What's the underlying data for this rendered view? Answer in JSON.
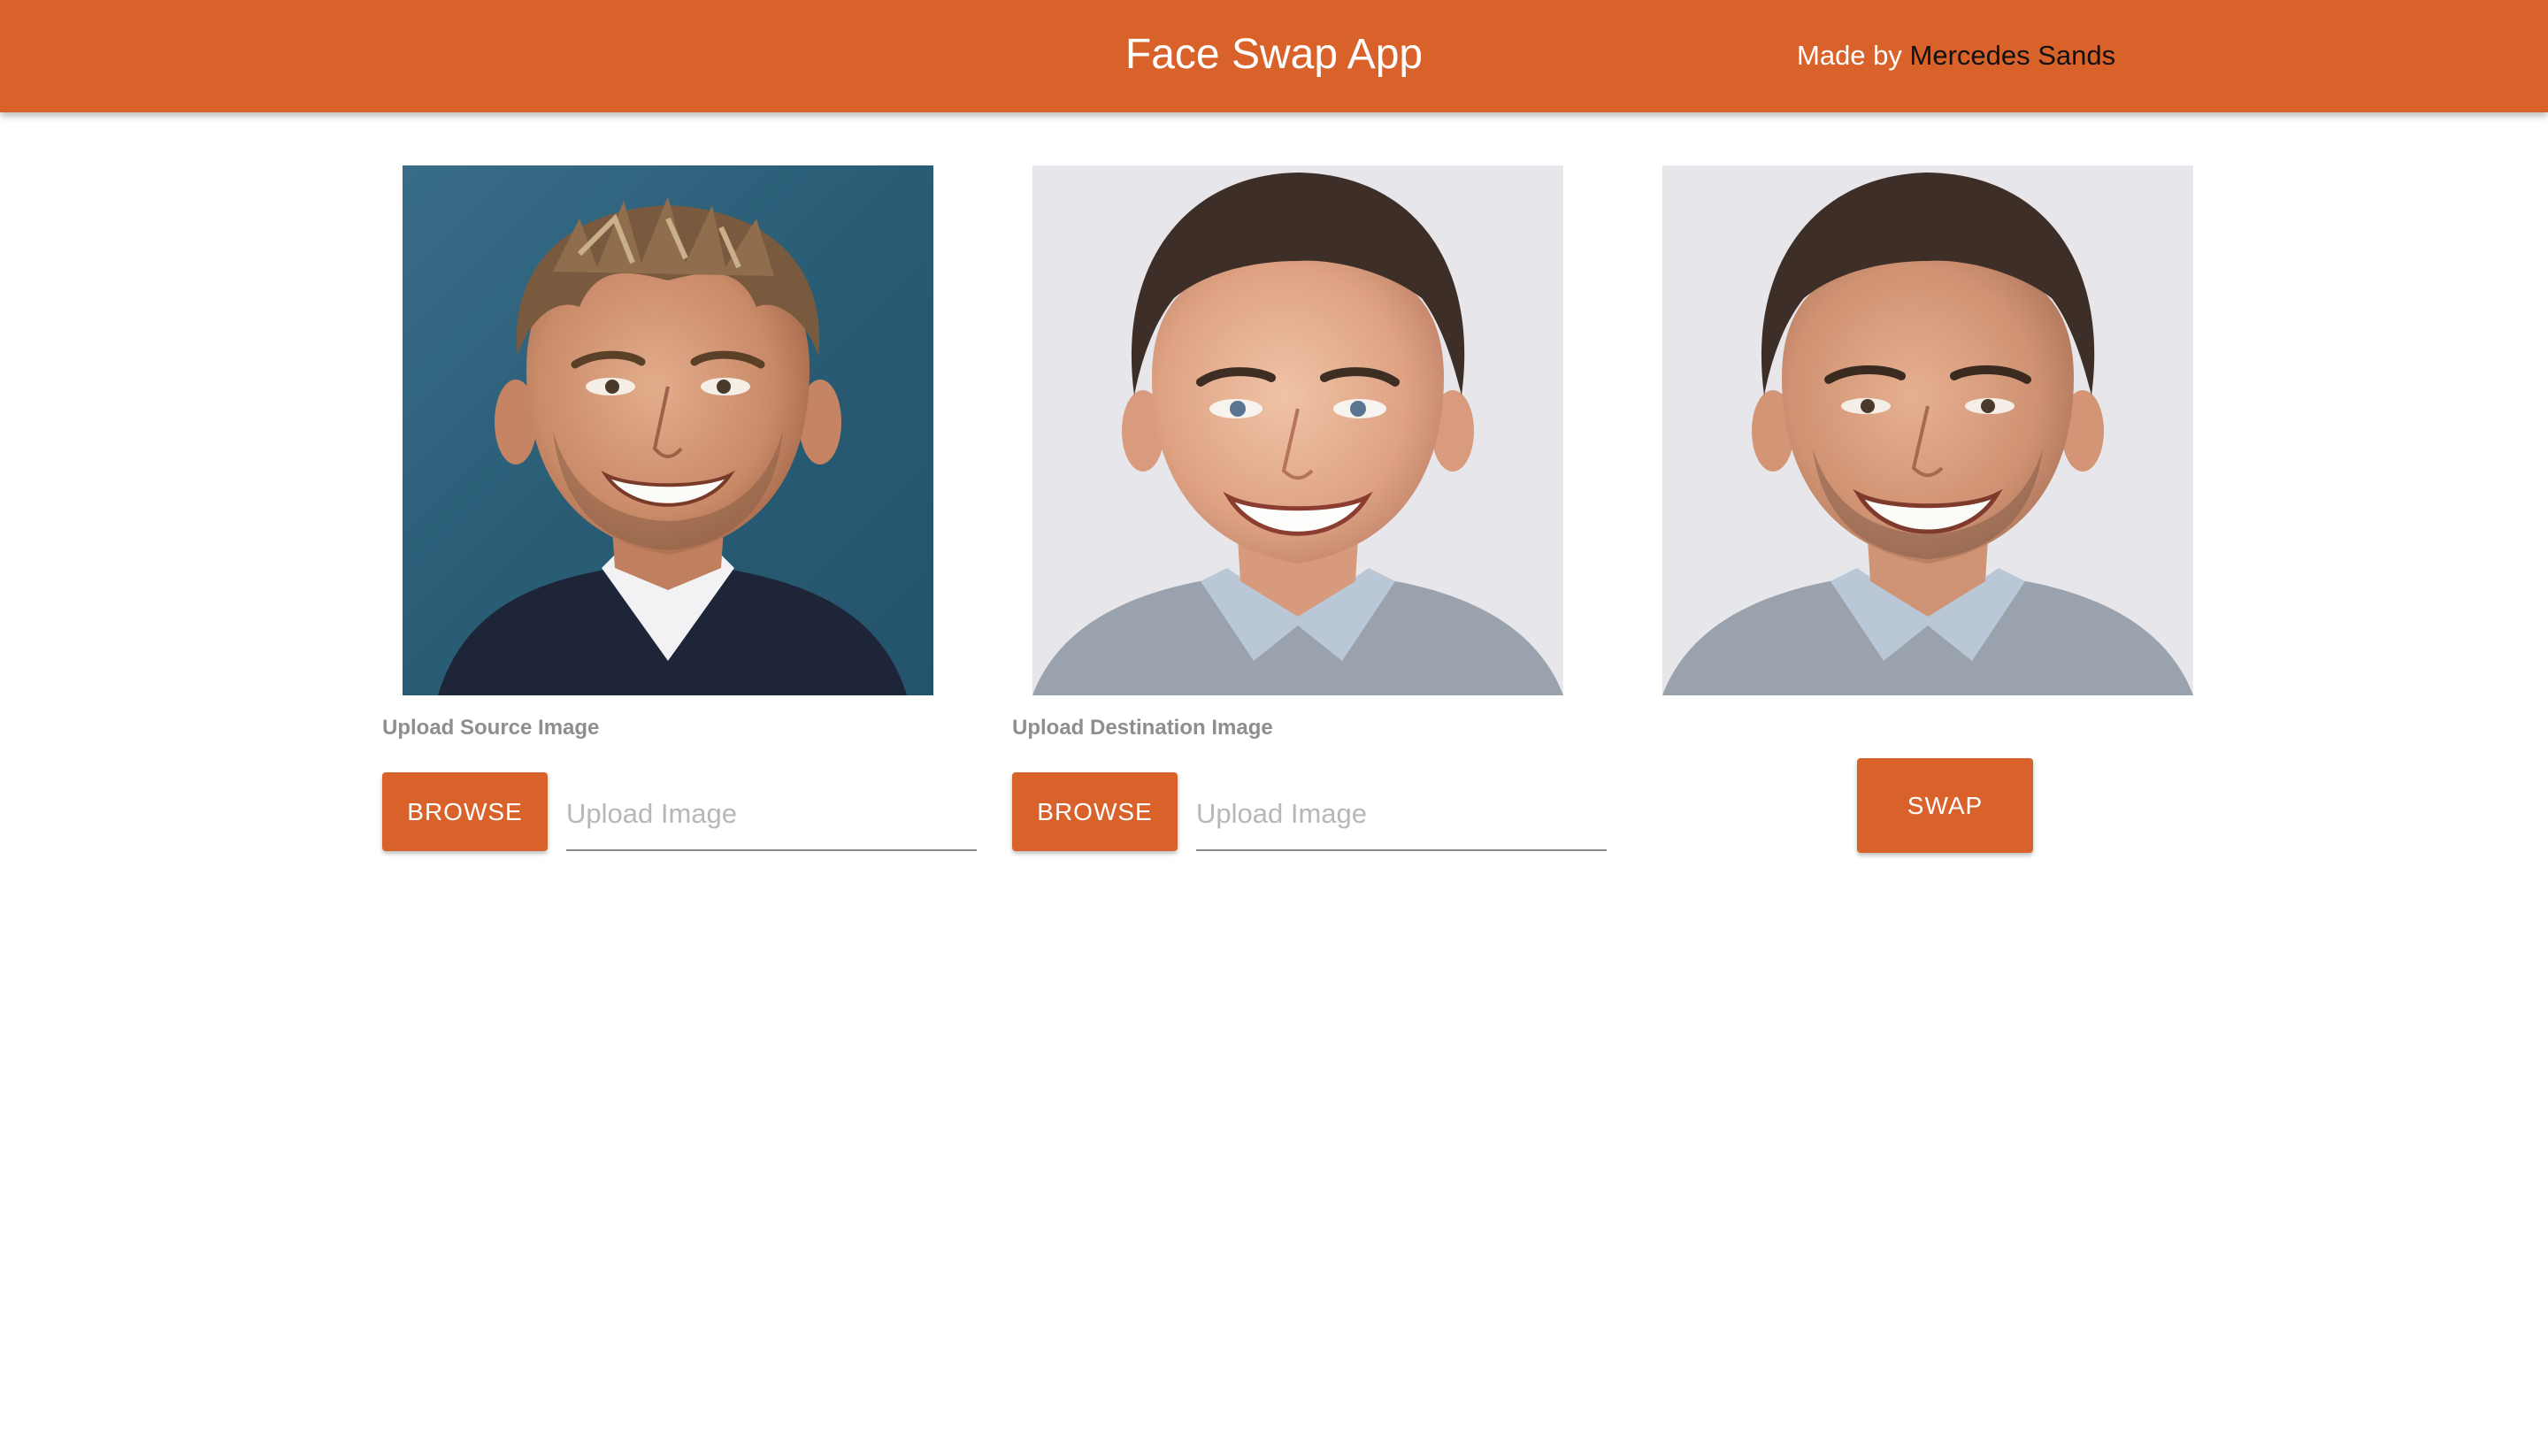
{
  "header": {
    "title": "Face Swap App",
    "credit_prefix": "Made by",
    "credit_author": "Mercedes Sands",
    "background_color": "#d9622b"
  },
  "panels": {
    "source": {
      "upload_label": "Upload Source Image",
      "browse_label": "BROWSE",
      "input_placeholder": "Upload Image"
    },
    "destination": {
      "upload_label": "Upload Destination Image",
      "browse_label": "BROWSE",
      "input_placeholder": "Upload Image"
    },
    "result": {
      "swap_label": "SWAP"
    }
  },
  "colors": {
    "accent": "#d9622b",
    "label_gray": "#8e8e8e",
    "placeholder_gray": "#b7b7b7"
  }
}
